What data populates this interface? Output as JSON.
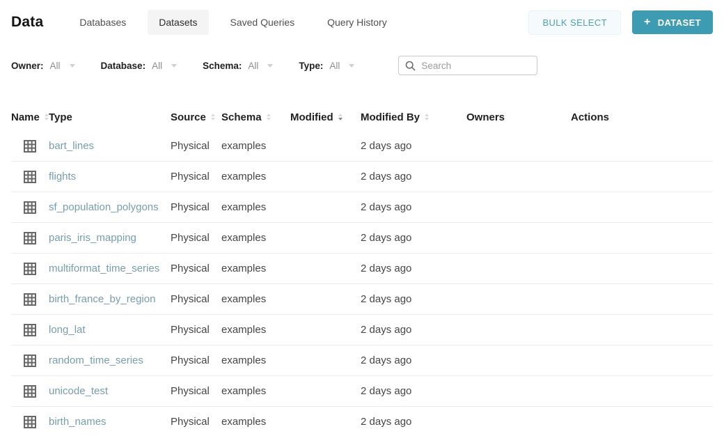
{
  "page": {
    "title": "Data"
  },
  "nav": {
    "tabs": [
      {
        "label": "Databases",
        "active": false
      },
      {
        "label": "Datasets",
        "active": true
      },
      {
        "label": "Saved Queries",
        "active": false
      },
      {
        "label": "Query History",
        "active": false
      }
    ]
  },
  "actions": {
    "bulk_select": "BULK SELECT",
    "add_dataset": "DATASET",
    "plus_icon": "+"
  },
  "filters": [
    {
      "label": "Owner:",
      "value": "All"
    },
    {
      "label": "Database:",
      "value": "All"
    },
    {
      "label": "Schema:",
      "value": "All"
    },
    {
      "label": "Type:",
      "value": "All"
    }
  ],
  "search": {
    "placeholder": "Search"
  },
  "table": {
    "columns": [
      {
        "label": "Name",
        "sort": "none"
      },
      {
        "label": "Type",
        "sort": null
      },
      {
        "label": "Source",
        "sort": "none"
      },
      {
        "label": "Schema",
        "sort": "none"
      },
      {
        "label": "Modified",
        "sort": "desc"
      },
      {
        "label": "Modified By",
        "sort": "none"
      },
      {
        "label": "Owners",
        "sort": null
      },
      {
        "label": "Actions",
        "sort": null
      }
    ],
    "rows": [
      {
        "name": "bart_lines",
        "type": "Physical",
        "source": "examples",
        "schema": "",
        "modified": "2 days ago",
        "modified_by": "",
        "owners": "",
        "actions": ""
      },
      {
        "name": "flights",
        "type": "Physical",
        "source": "examples",
        "schema": "",
        "modified": "2 days ago",
        "modified_by": "",
        "owners": "",
        "actions": ""
      },
      {
        "name": "sf_population_polygons",
        "type": "Physical",
        "source": "examples",
        "schema": "",
        "modified": "2 days ago",
        "modified_by": "",
        "owners": "",
        "actions": ""
      },
      {
        "name": "paris_iris_mapping",
        "type": "Physical",
        "source": "examples",
        "schema": "",
        "modified": "2 days ago",
        "modified_by": "",
        "owners": "",
        "actions": ""
      },
      {
        "name": "multiformat_time_series",
        "type": "Physical",
        "source": "examples",
        "schema": "",
        "modified": "2 days ago",
        "modified_by": "",
        "owners": "",
        "actions": ""
      },
      {
        "name": "birth_france_by_region",
        "type": "Physical",
        "source": "examples",
        "schema": "",
        "modified": "2 days ago",
        "modified_by": "",
        "owners": "",
        "actions": ""
      },
      {
        "name": "long_lat",
        "type": "Physical",
        "source": "examples",
        "schema": "",
        "modified": "2 days ago",
        "modified_by": "",
        "owners": "",
        "actions": ""
      },
      {
        "name": "random_time_series",
        "type": "Physical",
        "source": "examples",
        "schema": "",
        "modified": "2 days ago",
        "modified_by": "",
        "owners": "",
        "actions": ""
      },
      {
        "name": "unicode_test",
        "type": "Physical",
        "source": "examples",
        "schema": "",
        "modified": "2 days ago",
        "modified_by": "",
        "owners": "",
        "actions": ""
      },
      {
        "name": "birth_names",
        "type": "Physical",
        "source": "examples",
        "schema": "",
        "modified": "2 days ago",
        "modified_by": "",
        "owners": "",
        "actions": ""
      }
    ]
  },
  "colors": {
    "primary_button_bg": "#3d9cb2",
    "primary_button_text": "#ffffff",
    "bulk_select_bg": "#f5fafc",
    "bulk_select_text": "#4da0b5",
    "link": "#779dad",
    "active_tab_bg": "#f4f4f4",
    "row_divider": "#ededed"
  }
}
